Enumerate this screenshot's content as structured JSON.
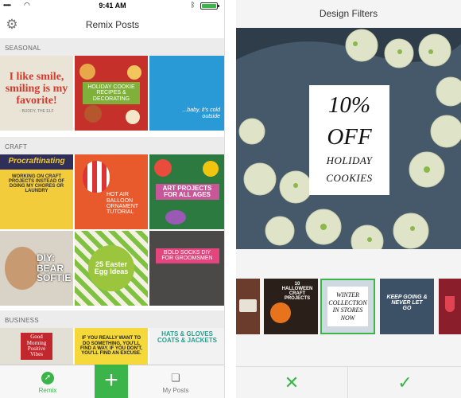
{
  "left": {
    "status": {
      "signal": "•••••",
      "time": "9:41 AM"
    },
    "title": "Remix Posts",
    "sections": [
      {
        "label": "SEASONAL"
      },
      {
        "label": "CRAFT"
      },
      {
        "label": "BUSINESS"
      }
    ],
    "tiles": {
      "smile": "I like smile, smiling is my favorite!",
      "smile_by": "- BUDDY, THE ELF",
      "cookie_recipes": "HOLIDAY COOKIE RECIPES & DECORATING",
      "baby": "...baby, it's cold outside",
      "procrastinating": "Procraftinating",
      "procrastinating_sub": "WORKING ON CRAFT PROJECTS INSTEAD OF DOING MY CHORES OR LAUNDRY",
      "hot_air": "HOT AIR BALLOON ORNAMENT TUTORIAL",
      "art_projects": "ART PROJECTS FOR ALL AGES",
      "diy_bear": "DIY: BEAR SOFTIE",
      "easter": "25 Easter Egg Ideas",
      "socks": "BOLD SOCKS DIY FOR GROOMSMEN",
      "good_morning": "Good Morning Positive Vibes",
      "if_you": "IF YOU REALLY WANT TO DO SOMETHING, YOU'LL FIND A WAY. IF YOU DON'T, YOU'LL FIND AN EXCUSE.",
      "hats": "HATS & GLOVES COATS & JACKETS"
    },
    "tabs": {
      "remix": "Remix",
      "my_posts": "My Posts"
    }
  },
  "right": {
    "title": "Design Filters",
    "promo": {
      "line1": "10%",
      "line2": "OFF",
      "line3": "HOLIDAY",
      "line4": "COOKIES"
    },
    "filters": {
      "halloween": "10 HALLOWEEN CRAFT PROJECTS",
      "winter": "WINTER COLLECTION IN STORES NOW",
      "keep": "KEEP GOING & NEVER LET GO"
    }
  },
  "colors": {
    "accent": "#3bb54a"
  }
}
